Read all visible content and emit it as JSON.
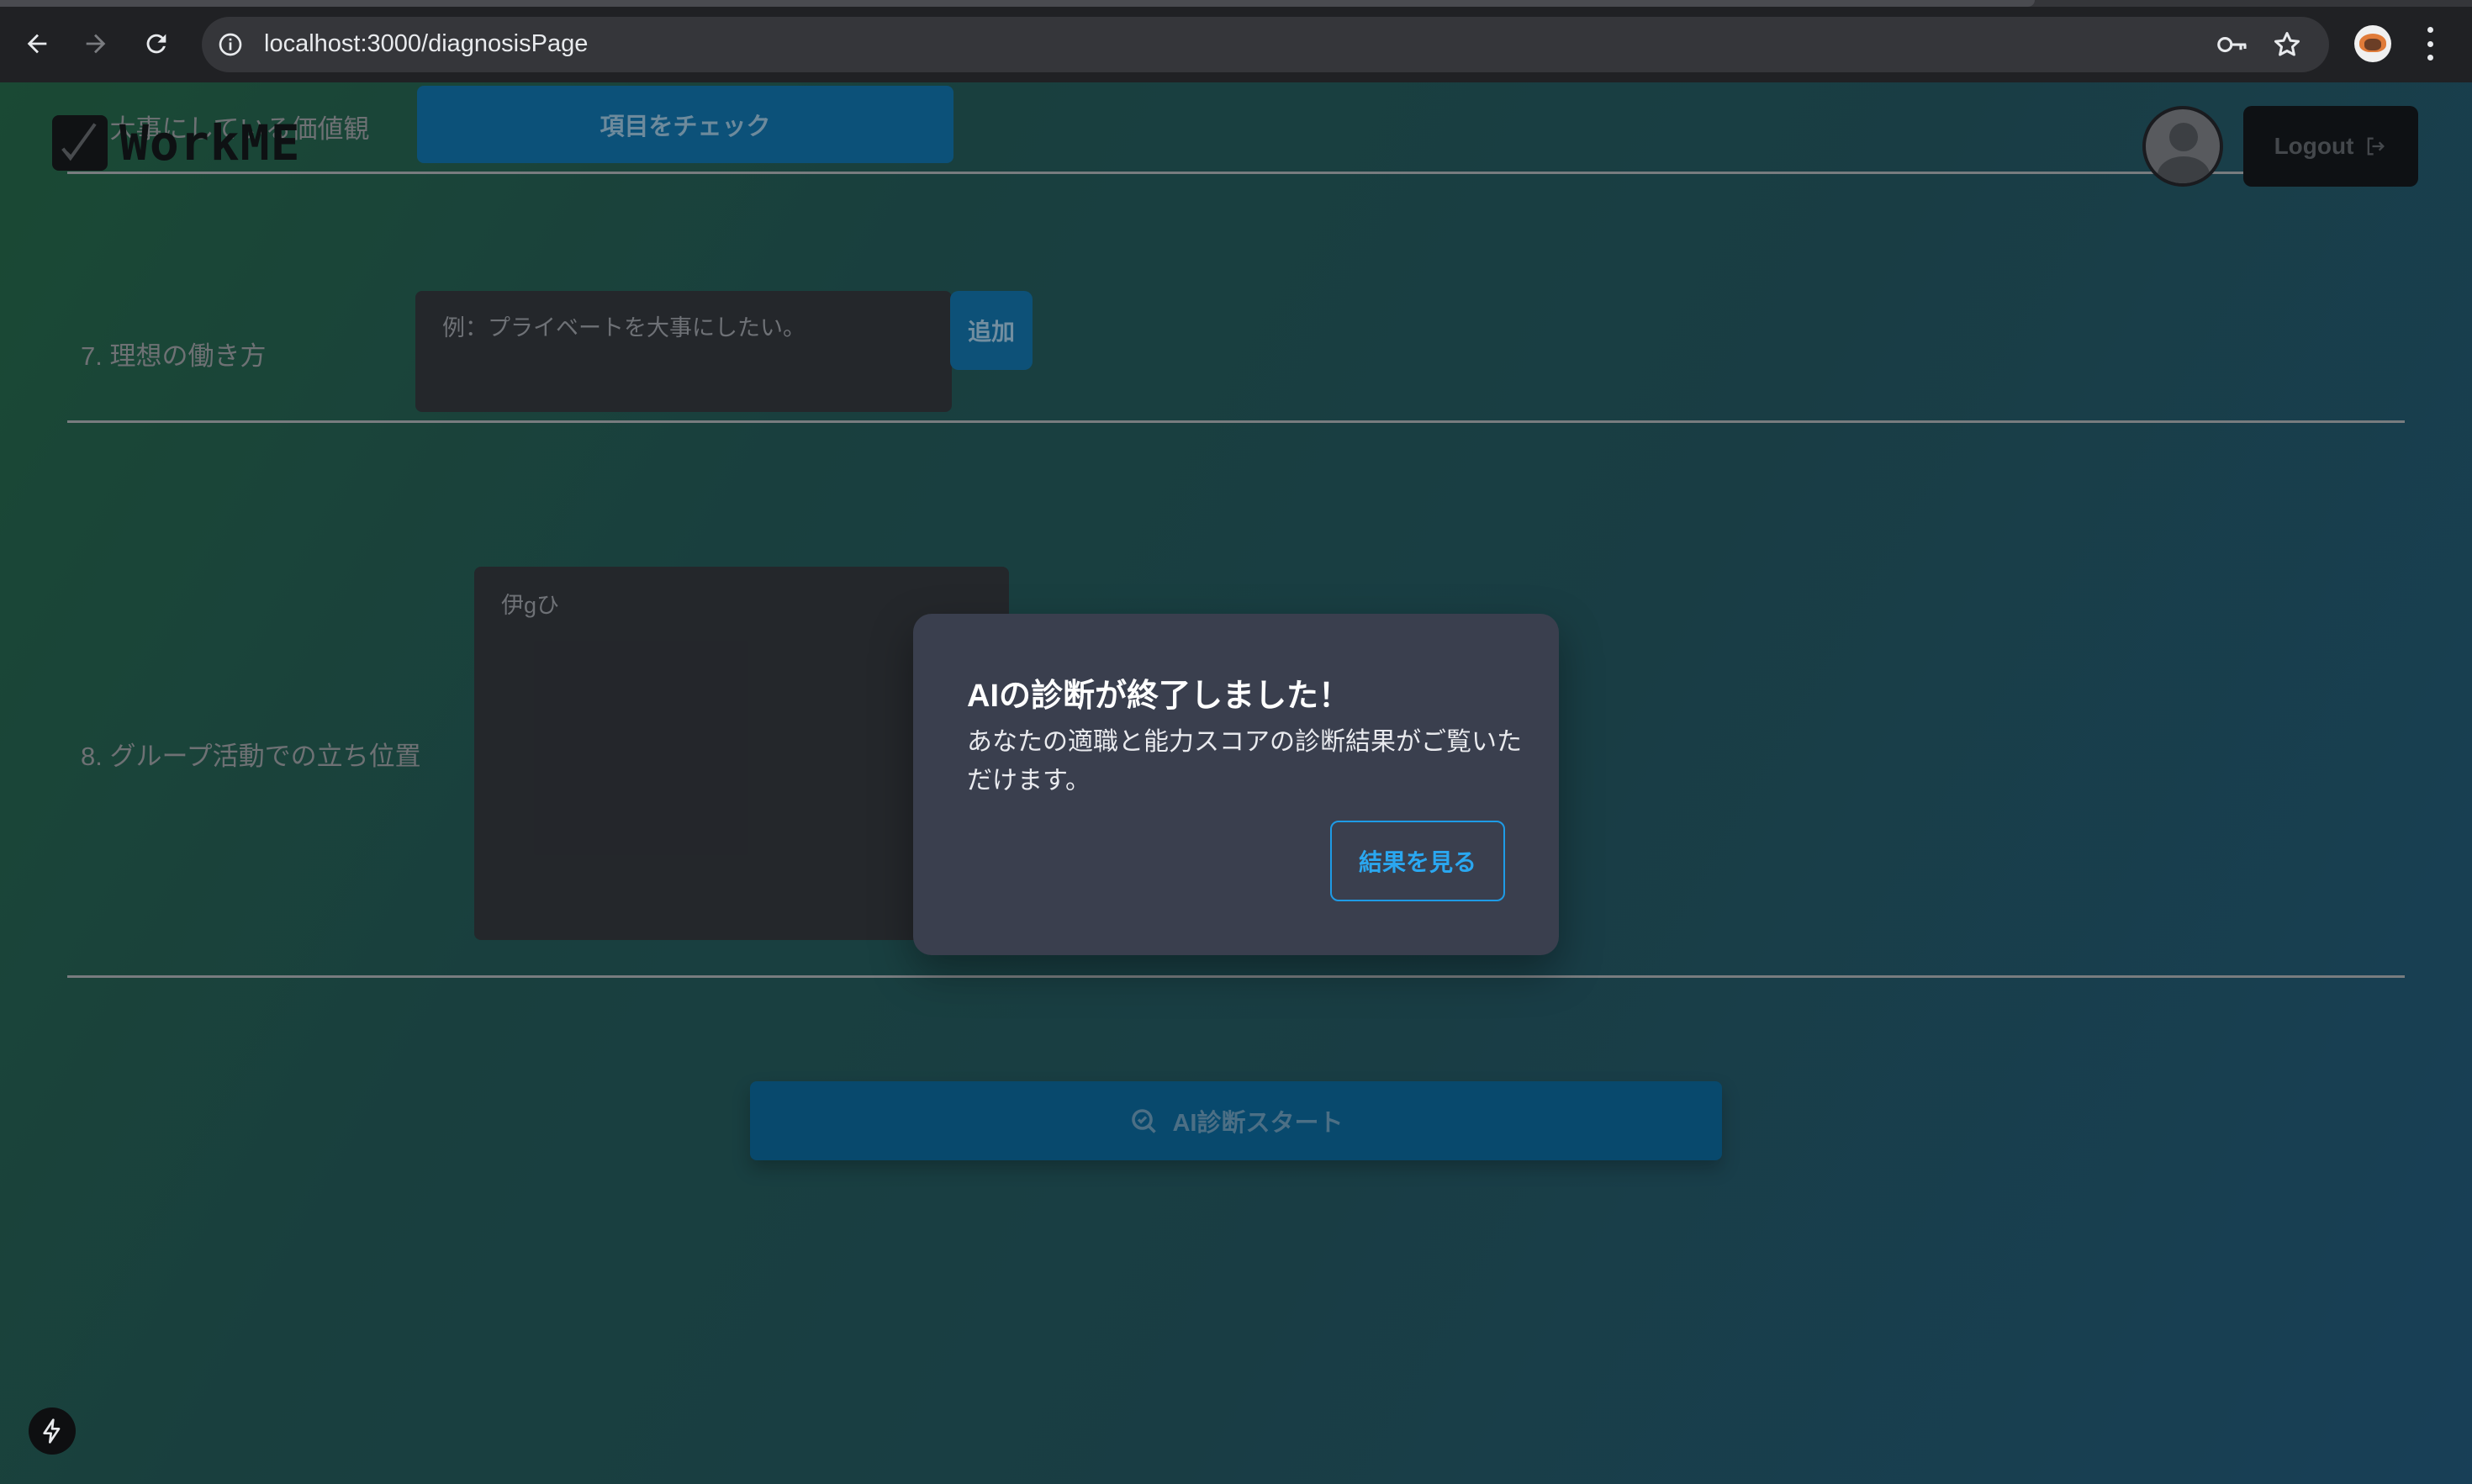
{
  "browser": {
    "url": "localhost:3000/diagnosisPage"
  },
  "header": {
    "logo_text": "WorkME",
    "logout_label": "Logout"
  },
  "form": {
    "q6_label": "6. 大事にしている価値観",
    "check_button": "項目をチェック",
    "q7_label": "7. 理想の働き方",
    "q7_placeholder": "例：プライベートを大事にしたい。",
    "add_button": "追加",
    "q8_label": "8. グループ活動での立ち位置",
    "q8_value": "伊gひ",
    "ai_start_button": "AI診断スタート"
  },
  "modal": {
    "title": "AIの診断が終了しました！",
    "message": "あなたの適職と能力スコアの診断結果がご覧いただけます。",
    "result_button": "結果を見る"
  },
  "icons": {
    "back": "arrow-left-icon",
    "forward": "arrow-right-icon",
    "reload": "reload-icon",
    "site_info": "info-icon",
    "password": "key-icon",
    "bookmark": "star-icon",
    "menu": "more-vert-icon",
    "search": "search-check-icon",
    "logout": "logout-icon",
    "dev_tools": "bolt-icon"
  },
  "colors": {
    "accent": "#1e9be6",
    "primary_button": "#0a6498",
    "modal_bg": "#3a3f4e"
  }
}
